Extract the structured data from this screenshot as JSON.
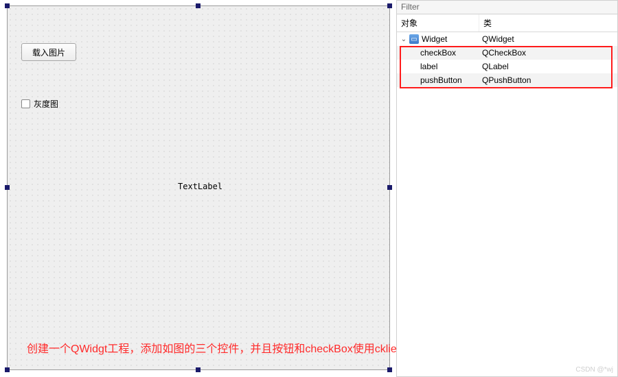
{
  "colors": {
    "highlight": "#ff1a1a"
  },
  "designer": {
    "pushButton": {
      "label": "载入图片"
    },
    "checkBox": {
      "label": "灰度图"
    },
    "textLabel": {
      "text": "TextLabel"
    },
    "caption": "创建一个QWidgt工程，添加如图的三个控件，并且按钮和checkBox使用cklied()槽函数"
  },
  "inspector": {
    "filterLabel": "Filter",
    "columns": {
      "object": "对象",
      "class": "类"
    },
    "root": {
      "name": "Widget",
      "cls": "QWidget"
    },
    "children": [
      {
        "name": "checkBox",
        "cls": "QCheckBox"
      },
      {
        "name": "label",
        "cls": "QLabel"
      },
      {
        "name": "pushButton",
        "cls": "QPushButton"
      }
    ]
  },
  "watermark": "CSDN @*wj"
}
